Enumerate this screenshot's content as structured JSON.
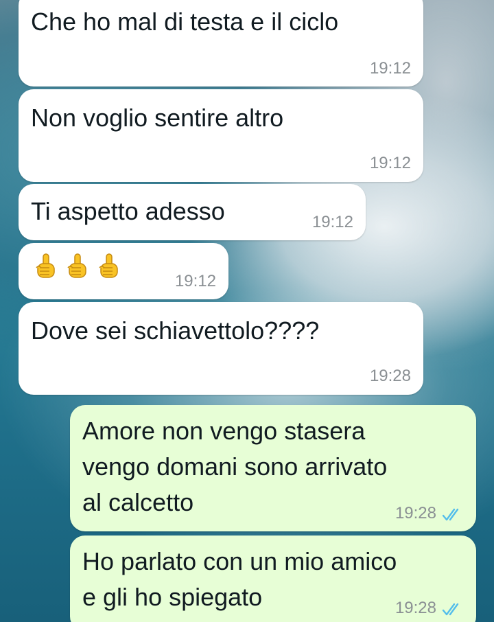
{
  "colors": {
    "incoming_bubble": "#ffffff",
    "outgoing_bubble": "#e7fed6",
    "timestamp": "#8a8f93",
    "read_receipt": "#53bdeb"
  },
  "messages": [
    {
      "direction": "incoming",
      "text": "Che ho mal di testa e il ciclo",
      "time": "19:12"
    },
    {
      "direction": "incoming",
      "text": "Non voglio sentire altro",
      "time": "19:12"
    },
    {
      "direction": "incoming",
      "text": "Ti aspetto adesso",
      "time": "19:12"
    },
    {
      "direction": "incoming",
      "emoji": [
        "index-pointing-up-emoji",
        "index-pointing-up-emoji",
        "index-pointing-up-emoji"
      ],
      "time": "19:12"
    },
    {
      "direction": "incoming",
      "text": "Dove sei schiavettolo????",
      "time": "19:28"
    },
    {
      "direction": "outgoing",
      "text": "Amore non vengo stasera\nvengo domani sono arrivato\nal calcetto",
      "time": "19:28",
      "status_icon": "double-check-read-icon"
    },
    {
      "direction": "outgoing",
      "text": "Ho parlato con un mio amico\ne gli ho spiegato",
      "time": "19:28",
      "status_icon": "double-check-read-icon"
    }
  ]
}
